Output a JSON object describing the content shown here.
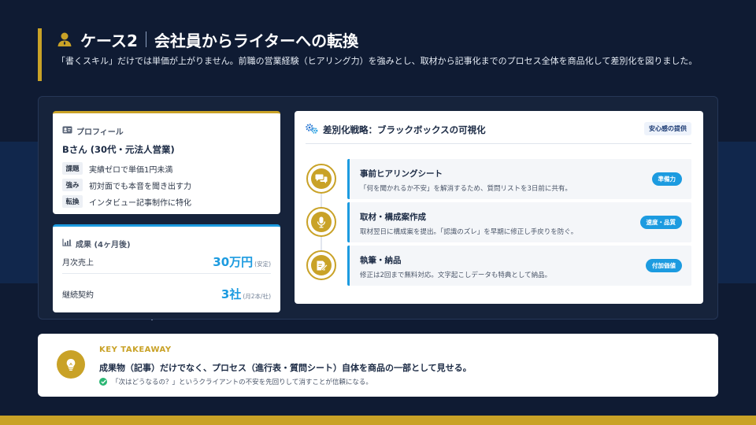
{
  "header": {
    "case_label": "ケース2",
    "title": "会社員からライターへの転換",
    "subtitle": "「書くスキル」だけでは単価が上がりません。前職の営業経験（ヒアリング力）を強みとし、取材から記事化までのプロセス全体を商品化して差別化を図りました。"
  },
  "profile": {
    "label": "プロフィール",
    "name": "Bさん (30代・元法人営業)",
    "rows": [
      {
        "tag": "課題",
        "text": "実績ゼロで単価1円未満"
      },
      {
        "tag": "強み",
        "text": "初対面でも本音を聞き出す力"
      },
      {
        "tag": "転換",
        "text": "インタビュー記事制作に特化"
      }
    ]
  },
  "results": {
    "label": "成果 (4ヶ月後)",
    "rows": [
      {
        "label": "月次売上",
        "value": "30万円",
        "note": "(安定)"
      },
      {
        "label": "継続契約",
        "value": "3社",
        "note": "(月2本/社)"
      }
    ]
  },
  "strategy": {
    "title": "差別化戦略：ブラックボックスの可視化",
    "badge": "安心感の提供",
    "steps": [
      {
        "title": "事前ヒアリングシート",
        "desc": "「何を聞かれるか不安」を解消するため、質問リストを3日前に共有。",
        "tag": "準備力"
      },
      {
        "title": "取材・構成案作成",
        "desc": "取材翌日に構成案を提出。「認識のズレ」を早期に修正し手戻りを防ぐ。",
        "tag": "速度・品質"
      },
      {
        "title": "執筆・納品",
        "desc": "修正は2回まで無料対応。文字起こしデータも特典として納品。",
        "tag": "付加価値"
      }
    ]
  },
  "takeaway": {
    "label": "KEY TAKEAWAY",
    "main": "成果物（記事）だけでなく、プロセス（進行表・質問シート）自体を商品の一部として見せる。",
    "sub": "「次はどうなるの？」というクライアントの不安を先回りして消すことが信頼になる。"
  },
  "colors": {
    "accent_gold": "#c9a227",
    "accent_blue": "#1c9be0",
    "background": "#0f1b33"
  },
  "icons": {
    "header": "person-icon",
    "profile": "id-card-icon",
    "results": "chart-icon",
    "strategy": "gears-icon",
    "steps": [
      "chat-bubbles-icon",
      "microphone-icon",
      "edit-document-icon"
    ],
    "takeaway": "lightbulb-icon",
    "check": "check-circle-icon"
  }
}
